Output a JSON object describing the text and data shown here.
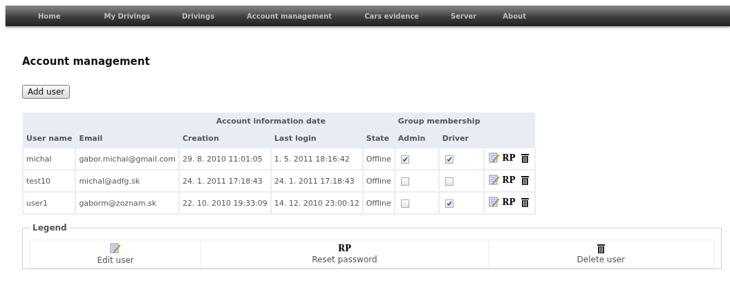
{
  "nav": [
    "Home",
    "My Drivings",
    "Drivings",
    "Account management",
    "Cars evidence",
    "Server",
    "About"
  ],
  "title": "Account management",
  "add_button": "Add user",
  "table": {
    "group_headers": [
      "Account information date",
      "Group membership"
    ],
    "columns": [
      "User name",
      "Email",
      "Creation",
      "Last login",
      "State",
      "Admin",
      "Driver"
    ],
    "rows": [
      {
        "user": "michal",
        "email": "gabor.michal@gmail.com",
        "creation": "29. 8. 2010 11:01:05",
        "last_login": "1. 5. 2011 18:16:42",
        "state": "Offline",
        "admin": true,
        "driver": true,
        "reset": "RP"
      },
      {
        "user": "test10",
        "email": "michal@adfg.sk",
        "creation": "24. 1. 2011 17:18:43",
        "last_login": "24. 1. 2011 17:18:43",
        "state": "Offline",
        "admin": false,
        "driver": false,
        "reset": "RP"
      },
      {
        "user": "user1",
        "email": "gaborm@zoznam.sk",
        "creation": "22. 10. 2010 19:33:09",
        "last_login": "14. 12. 2010 23:00:12",
        "state": "Offline",
        "admin": false,
        "driver": true,
        "reset": "RP"
      }
    ]
  },
  "legend": {
    "title": "Legend",
    "items": [
      {
        "kind": "edit",
        "label": "Edit user"
      },
      {
        "kind": "reset",
        "symbol": "RP",
        "label": "Reset password"
      },
      {
        "kind": "delete",
        "label": "Delete user"
      }
    ]
  }
}
